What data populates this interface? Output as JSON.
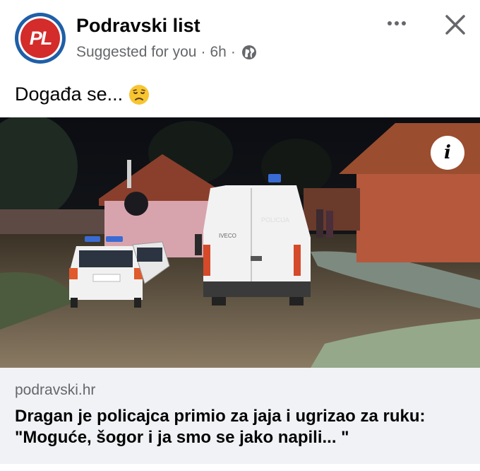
{
  "post": {
    "page_name": "Podravski list",
    "avatar_text": "PL",
    "suggested": "Suggested for you",
    "separator": "·",
    "time": "6h",
    "privacy_icon": "globe-icon",
    "text": "Događa se...",
    "emoji": "disappointed-face-emoji",
    "more_icon": "more-horizontal-icon",
    "close_icon": "close-icon"
  },
  "photo": {
    "info_label": "i",
    "van_text": "POLICIJA"
  },
  "link": {
    "domain": "podravski.hr",
    "headline_line1": "Dragan je policajca primio za jaja i ugrizao za ruku:",
    "headline_line2": "\"Moguće, šogor i ja smo se jako napili... \""
  },
  "colors": {
    "brand_blue": "#1f5fa8",
    "brand_red": "#d42b2b",
    "meta_gray": "#65676b",
    "preview_bg": "#f0f2f5"
  }
}
